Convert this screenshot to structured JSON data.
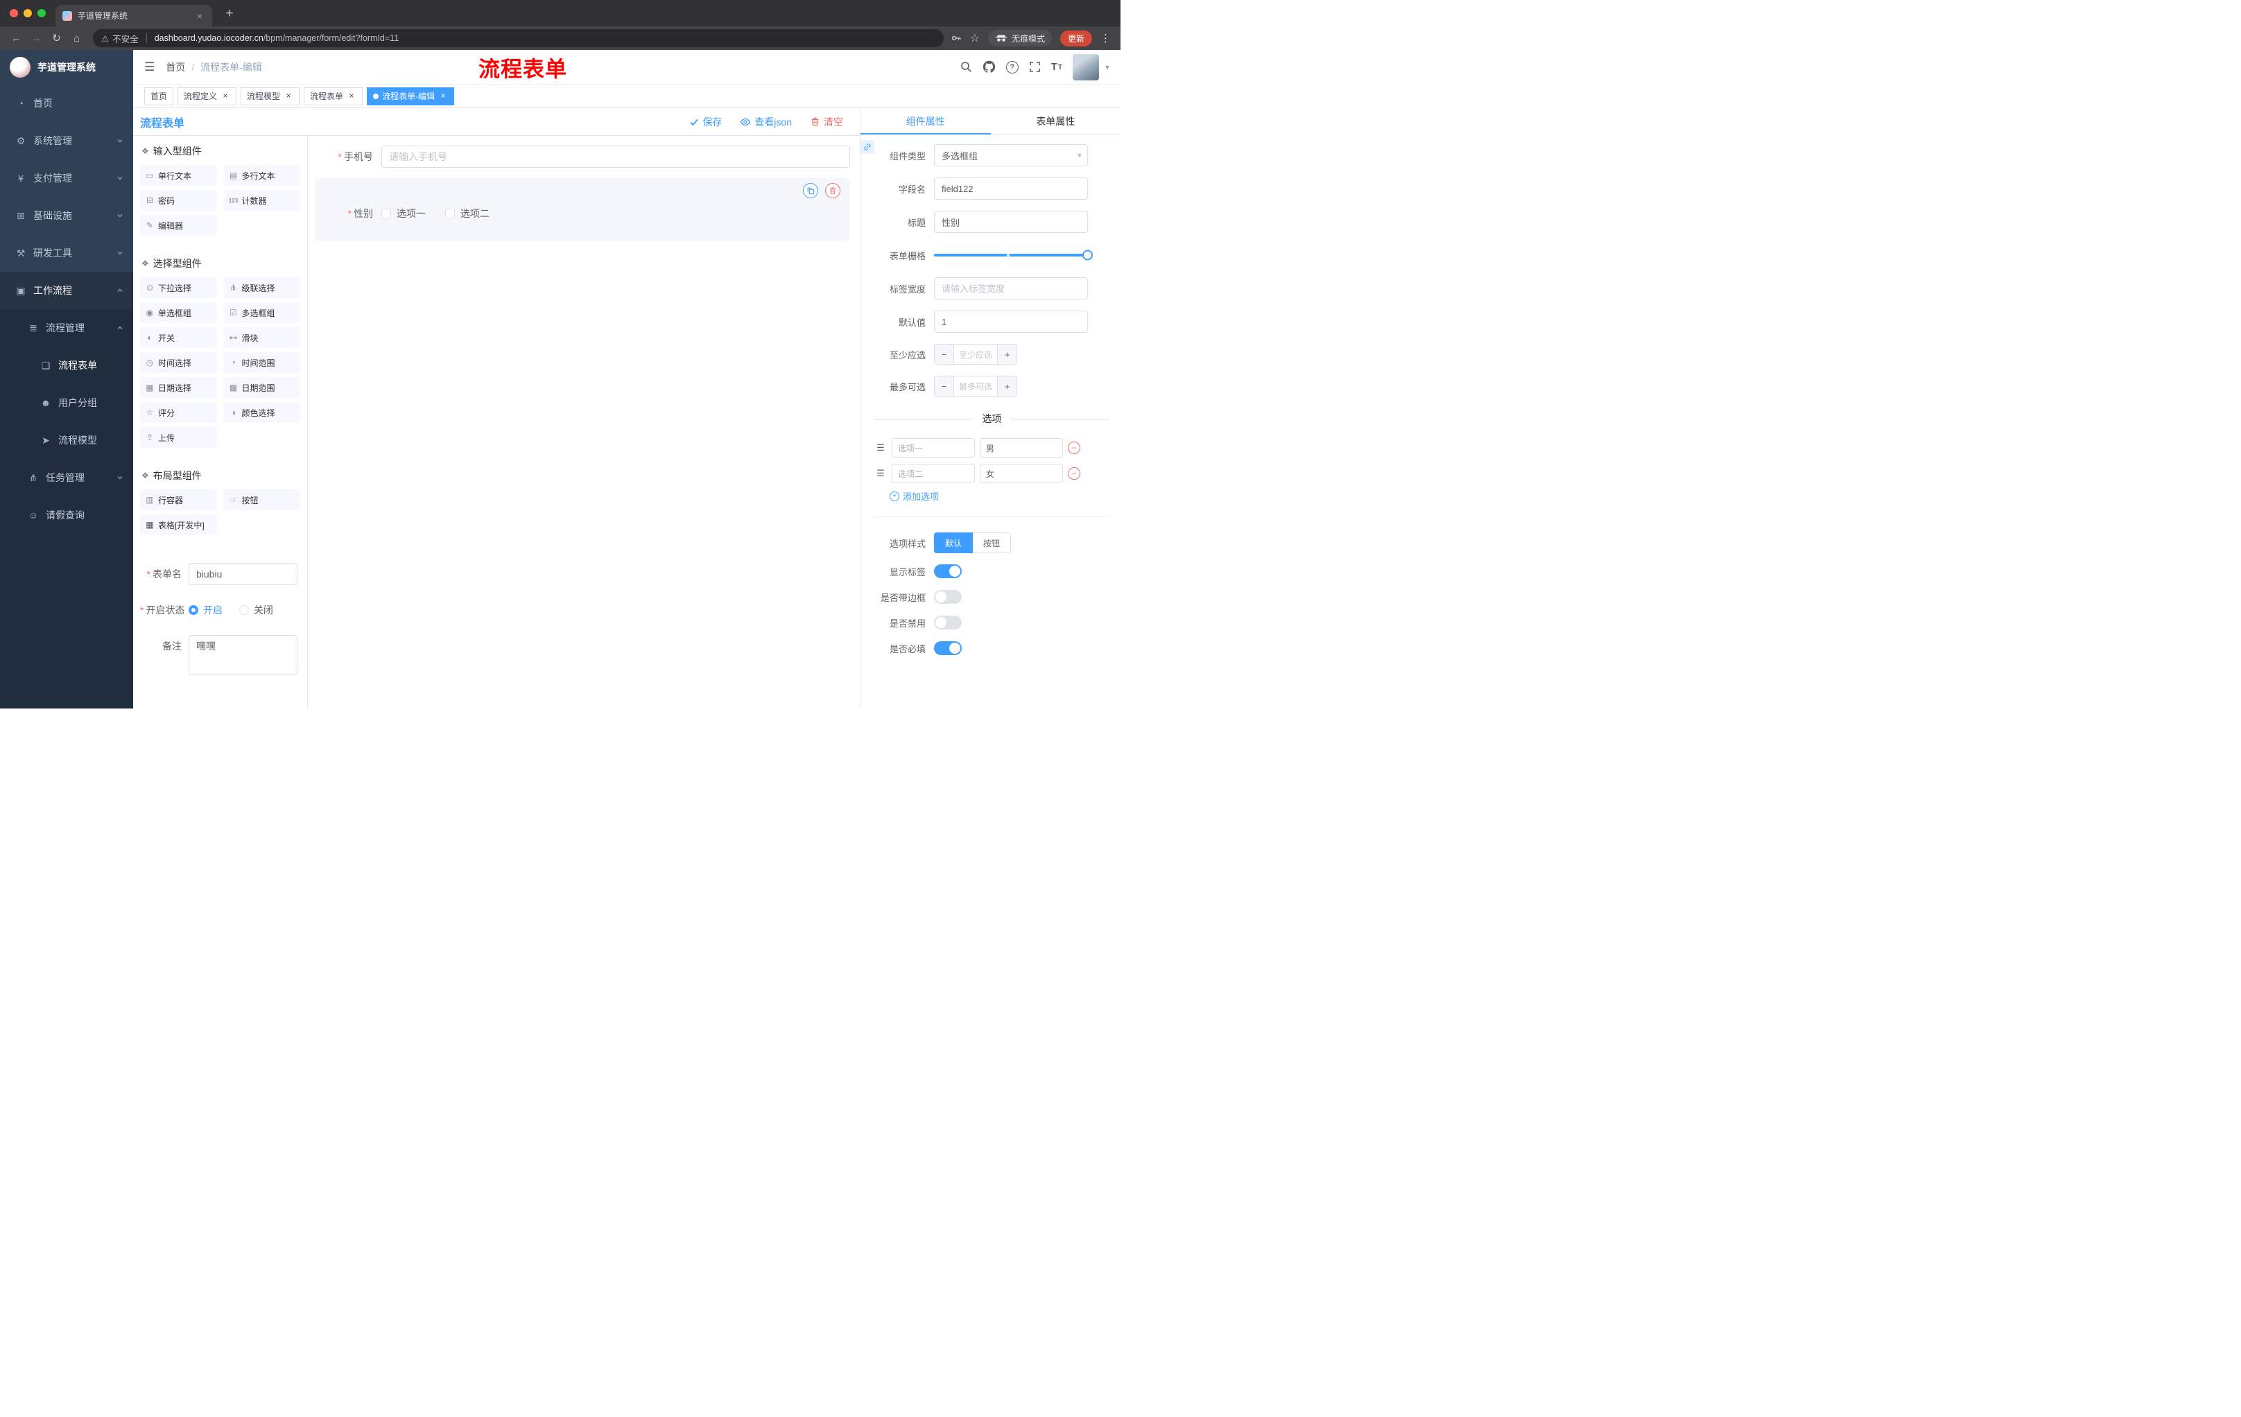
{
  "browser": {
    "tab_title": "芋道管理系统",
    "security_label": "不安全",
    "url_host": "dashboard.yudao.iocoder.cn",
    "url_path": "/bpm/manager/form/edit?formId=11",
    "incognito_label": "无痕模式",
    "update_label": "更新"
  },
  "header": {
    "breadcrumb_home": "首页",
    "breadcrumb_sep": "/",
    "breadcrumb_current": "流程表单-编辑",
    "annotation": "流程表单"
  },
  "sidebar": {
    "logo_title": "芋道管理系统",
    "items": [
      {
        "label": "首页"
      },
      {
        "label": "系统管理"
      },
      {
        "label": "支付管理"
      },
      {
        "label": "基础设施"
      },
      {
        "label": "研发工具"
      },
      {
        "label": "工作流程"
      }
    ],
    "workflow": {
      "process_mgmt": "流程管理",
      "process_children": [
        {
          "label": "流程表单"
        },
        {
          "label": "用户分组"
        },
        {
          "label": "流程模型"
        }
      ],
      "task_mgmt": "任务管理",
      "leave_query": "请假查询"
    }
  },
  "tags": [
    {
      "label": "首页"
    },
    {
      "label": "流程定义"
    },
    {
      "label": "流程模型"
    },
    {
      "label": "流程表单"
    },
    {
      "label": "流程表单-编辑"
    }
  ],
  "designer": {
    "title": "流程表单",
    "save": "保存",
    "view_json": "查看json",
    "clear": "清空"
  },
  "components": {
    "sections": [
      {
        "title": "输入型组件"
      },
      {
        "title": "选择型组件"
      },
      {
        "title": "布局型组件"
      }
    ],
    "inputs": [
      {
        "label": "单行文本"
      },
      {
        "label": "多行文本"
      },
      {
        "label": "密码"
      },
      {
        "label": "计数器"
      },
      {
        "label": "编辑器"
      }
    ],
    "selects": [
      {
        "label": "下拉选择"
      },
      {
        "label": "级联选择"
      },
      {
        "label": "单选框组"
      },
      {
        "label": "多选框组"
      },
      {
        "label": "开关"
      },
      {
        "label": "滑块"
      },
      {
        "label": "时间选择"
      },
      {
        "label": "时间范围"
      },
      {
        "label": "日期选择"
      },
      {
        "label": "日期范围"
      },
      {
        "label": "评分"
      },
      {
        "label": "颜色选择"
      },
      {
        "label": "上传"
      }
    ],
    "layouts": [
      {
        "label": "行容器"
      },
      {
        "label": "按钮"
      },
      {
        "label": "表格[开发中]"
      }
    ]
  },
  "form_settings": {
    "name_label": "表单名",
    "name_value": "biubiu",
    "status_label": "开启状态",
    "status_on": "开启",
    "status_off": "关闭",
    "remark_label": "备注",
    "remark_value": "嘿嘿"
  },
  "canvas": {
    "phone_label": "手机号",
    "phone_placeholder": "请输入手机号",
    "gender_label": "性别",
    "gender_option1": "选项一",
    "gender_option2": "选项二"
  },
  "panel": {
    "tab_component": "组件属性",
    "tab_form": "表单属性",
    "component_type_label": "组件类型",
    "component_type_value": "多选框组",
    "field_name_label": "字段名",
    "field_name_value": "field122",
    "title_label": "标题",
    "title_value": "性别",
    "grid_label": "表单栅格",
    "label_width_label": "标签宽度",
    "label_width_placeholder": "请输入标签宽度",
    "default_label": "默认值",
    "default_value": "1",
    "min_label": "至少应选",
    "min_placeholder": "至少应选",
    "max_label": "最多可选",
    "max_placeholder": "最多可选",
    "options_divider": "选项",
    "options": [
      {
        "label": "选项一",
        "value": "男"
      },
      {
        "label": "选项二",
        "value": "女"
      }
    ],
    "add_option": "添加选项",
    "style_label": "选项样式",
    "style_default": "默认",
    "style_button": "按钮",
    "switches": [
      {
        "label": "显示标签",
        "on": true
      },
      {
        "label": "是否带边框",
        "on": false
      },
      {
        "label": "是否禁用",
        "on": false
      },
      {
        "label": "是否必填",
        "on": true
      }
    ]
  },
  "colors": {
    "primary": "#409eff",
    "danger": "#f56c6c",
    "annotation_red": "#ff0000",
    "sidebar_bg": "#304156",
    "submenu_bg": "#1f2d3d"
  },
  "icons": {
    "hamburger": "☰",
    "dashboard": "◔",
    "gear": "⚙",
    "payment": "¥",
    "infra": "⊞",
    "tools": "⚒",
    "workflow": "▣",
    "process_mgmt": "≣",
    "form_doc": "❏",
    "user_group": "☻",
    "process_model": "➤",
    "task_mgmt": "⋔",
    "person": "☺",
    "section": "❖",
    "input_single": "▭",
    "input_multi": "▤",
    "password": "⊟",
    "counter": "123",
    "editor": "✎",
    "select": "⊙",
    "cascade": "⋔",
    "radio_group": "◉",
    "checkbox_group": "☑",
    "switch": "◐",
    "slider": "⊷",
    "time": "◷",
    "time_range": "◔",
    "date": "▦",
    "date_range": "▩",
    "rate": "☆",
    "color": "◑",
    "upload": "⇪",
    "row_container": "▥",
    "button": "☞",
    "table": "▦",
    "drag": "☰",
    "warning": "⚠",
    "back": "←",
    "forward": "→",
    "reload": "↻",
    "home": "⌂",
    "star": "☆",
    "dots": "⋮",
    "caret": "▾",
    "close": "×",
    "new_tab": "+",
    "minus": "−",
    "plus": "+",
    "question_mark": "?",
    "text_size": "T"
  }
}
